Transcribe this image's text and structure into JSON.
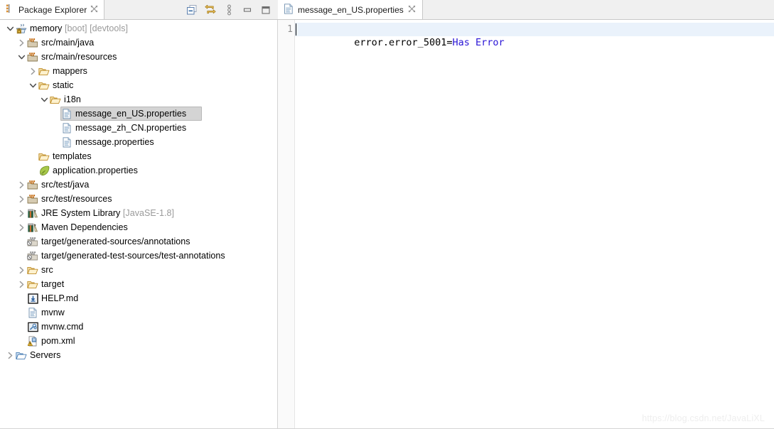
{
  "view": {
    "tab_label": "Package Explorer",
    "tab_icon": "package-explorer-icon",
    "close_icon": "close-icon",
    "toolbar": [
      {
        "name": "collapse-all-icon",
        "title": "Collapse All"
      },
      {
        "name": "link-with-editor-icon",
        "title": "Link with Editor"
      },
      {
        "name": "view-menu-icon",
        "title": "View Menu"
      },
      {
        "name": "minimize-icon",
        "title": "Minimize"
      },
      {
        "name": "maximize-icon",
        "title": "Maximize"
      }
    ]
  },
  "tree": [
    {
      "label": "memory",
      "suffix": " [boot] [devtools]",
      "icon": "java-project-icon",
      "arrow": "expanded",
      "depth": 0,
      "selected": false
    },
    {
      "label": "src/main/java",
      "suffix": "",
      "icon": "source-folder-icon",
      "arrow": "collapsed",
      "depth": 1,
      "selected": false
    },
    {
      "label": "src/main/resources",
      "suffix": "",
      "icon": "source-folder-icon",
      "arrow": "expanded",
      "depth": 1,
      "selected": false
    },
    {
      "label": "mappers",
      "suffix": "",
      "icon": "folder-icon",
      "arrow": "collapsed",
      "depth": 2,
      "selected": false
    },
    {
      "label": "static",
      "suffix": "",
      "icon": "folder-icon",
      "arrow": "expanded",
      "depth": 2,
      "selected": false
    },
    {
      "label": "i18n",
      "suffix": "",
      "icon": "folder-icon",
      "arrow": "expanded",
      "depth": 3,
      "selected": false
    },
    {
      "label": "message_en_US.properties",
      "suffix": "",
      "icon": "file-icon",
      "arrow": "none",
      "depth": 4,
      "selected": true
    },
    {
      "label": "message_zh_CN.properties",
      "suffix": "",
      "icon": "file-icon",
      "arrow": "none",
      "depth": 4,
      "selected": false
    },
    {
      "label": "message.properties",
      "suffix": "",
      "icon": "file-icon",
      "arrow": "none",
      "depth": 4,
      "selected": false
    },
    {
      "label": "templates",
      "suffix": "",
      "icon": "folder-icon",
      "arrow": "none",
      "depth": 2,
      "selected": false
    },
    {
      "label": "application.properties",
      "suffix": "",
      "icon": "spring-properties-icon",
      "arrow": "none",
      "depth": 2,
      "selected": false
    },
    {
      "label": "src/test/java",
      "suffix": "",
      "icon": "source-folder-icon",
      "arrow": "collapsed",
      "depth": 1,
      "selected": false
    },
    {
      "label": "src/test/resources",
      "suffix": "",
      "icon": "source-folder-icon",
      "arrow": "collapsed",
      "depth": 1,
      "selected": false
    },
    {
      "label": "JRE System Library",
      "suffix": " [JavaSE-1.8]",
      "icon": "library-icon",
      "arrow": "collapsed",
      "depth": 1,
      "selected": false
    },
    {
      "label": "Maven Dependencies",
      "suffix": "",
      "icon": "library-icon",
      "arrow": "collapsed",
      "depth": 1,
      "selected": false
    },
    {
      "label": "target/generated-sources/annotations",
      "suffix": "",
      "icon": "excluded-source-folder-icon",
      "arrow": "none",
      "depth": 1,
      "selected": false
    },
    {
      "label": "target/generated-test-sources/test-annotations",
      "suffix": "",
      "icon": "excluded-source-folder-icon",
      "arrow": "none",
      "depth": 1,
      "selected": false
    },
    {
      "label": "src",
      "suffix": "",
      "icon": "folder-icon",
      "arrow": "collapsed",
      "depth": 1,
      "selected": false
    },
    {
      "label": "target",
      "suffix": "",
      "icon": "folder-icon",
      "arrow": "collapsed",
      "depth": 1,
      "selected": false
    },
    {
      "label": "HELP.md",
      "suffix": "",
      "icon": "markdown-file-icon",
      "arrow": "none",
      "depth": 1,
      "selected": false
    },
    {
      "label": "mvnw",
      "suffix": "",
      "icon": "file-icon",
      "arrow": "none",
      "depth": 1,
      "selected": false
    },
    {
      "label": "mvnw.cmd",
      "suffix": "",
      "icon": "cmd-file-icon",
      "arrow": "none",
      "depth": 1,
      "selected": false
    },
    {
      "label": "pom.xml",
      "suffix": "",
      "icon": "maven-pom-icon",
      "arrow": "none",
      "depth": 1,
      "selected": false
    },
    {
      "label": "Servers",
      "suffix": "",
      "icon": "servers-folder-icon",
      "arrow": "collapsed",
      "depth": 0,
      "selected": false
    }
  ],
  "editor": {
    "tab_label": "message_en_US.properties",
    "tab_icon": "properties-file-icon",
    "close_icon": "close-icon",
    "lines": [
      {
        "number": "1",
        "key": "error.error_5001=",
        "value": "Has Error"
      }
    ]
  },
  "watermark": "https://blog.csdn.net/JavaLiXL",
  "colors": {
    "selection_bg": "#d4d4d4",
    "current_line_bg": "#eaf2fb",
    "value_text": "#2a15d6",
    "dim_text": "#9a9a9a"
  }
}
